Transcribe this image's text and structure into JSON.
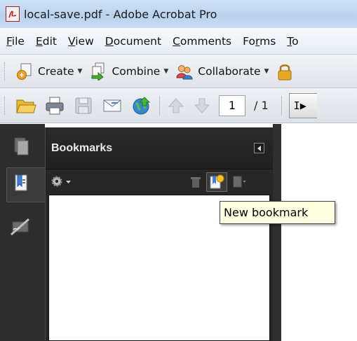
{
  "window": {
    "title": "local-save.pdf - Adobe Acrobat Pro",
    "icon": "acrobat-pdf-icon"
  },
  "menu": [
    {
      "pre": "",
      "key": "F",
      "post": "ile"
    },
    {
      "pre": "",
      "key": "E",
      "post": "dit"
    },
    {
      "pre": "",
      "key": "V",
      "post": "iew"
    },
    {
      "pre": "",
      "key": "D",
      "post": "ocument"
    },
    {
      "pre": "",
      "key": "C",
      "post": "omments"
    },
    {
      "pre": "Fo",
      "key": "r",
      "post": "ms"
    },
    {
      "pre": "",
      "key": "T",
      "post": "o"
    }
  ],
  "toolbar1": {
    "create_label": "Create",
    "combine_label": "Combine",
    "collaborate_label": "Collaborate"
  },
  "toolbar2": {
    "page_number": "1",
    "page_total": "/ 1",
    "select_tool_label": "I"
  },
  "bookmarks_panel": {
    "title": "Bookmarks"
  },
  "tooltip": {
    "text": "New bookmark"
  },
  "colors": {
    "panel_bg": "#262626",
    "nav_bg": "#2d2d2d",
    "tooltip_bg": "#ffffe1",
    "acrobat_red": "#b01c1c"
  }
}
